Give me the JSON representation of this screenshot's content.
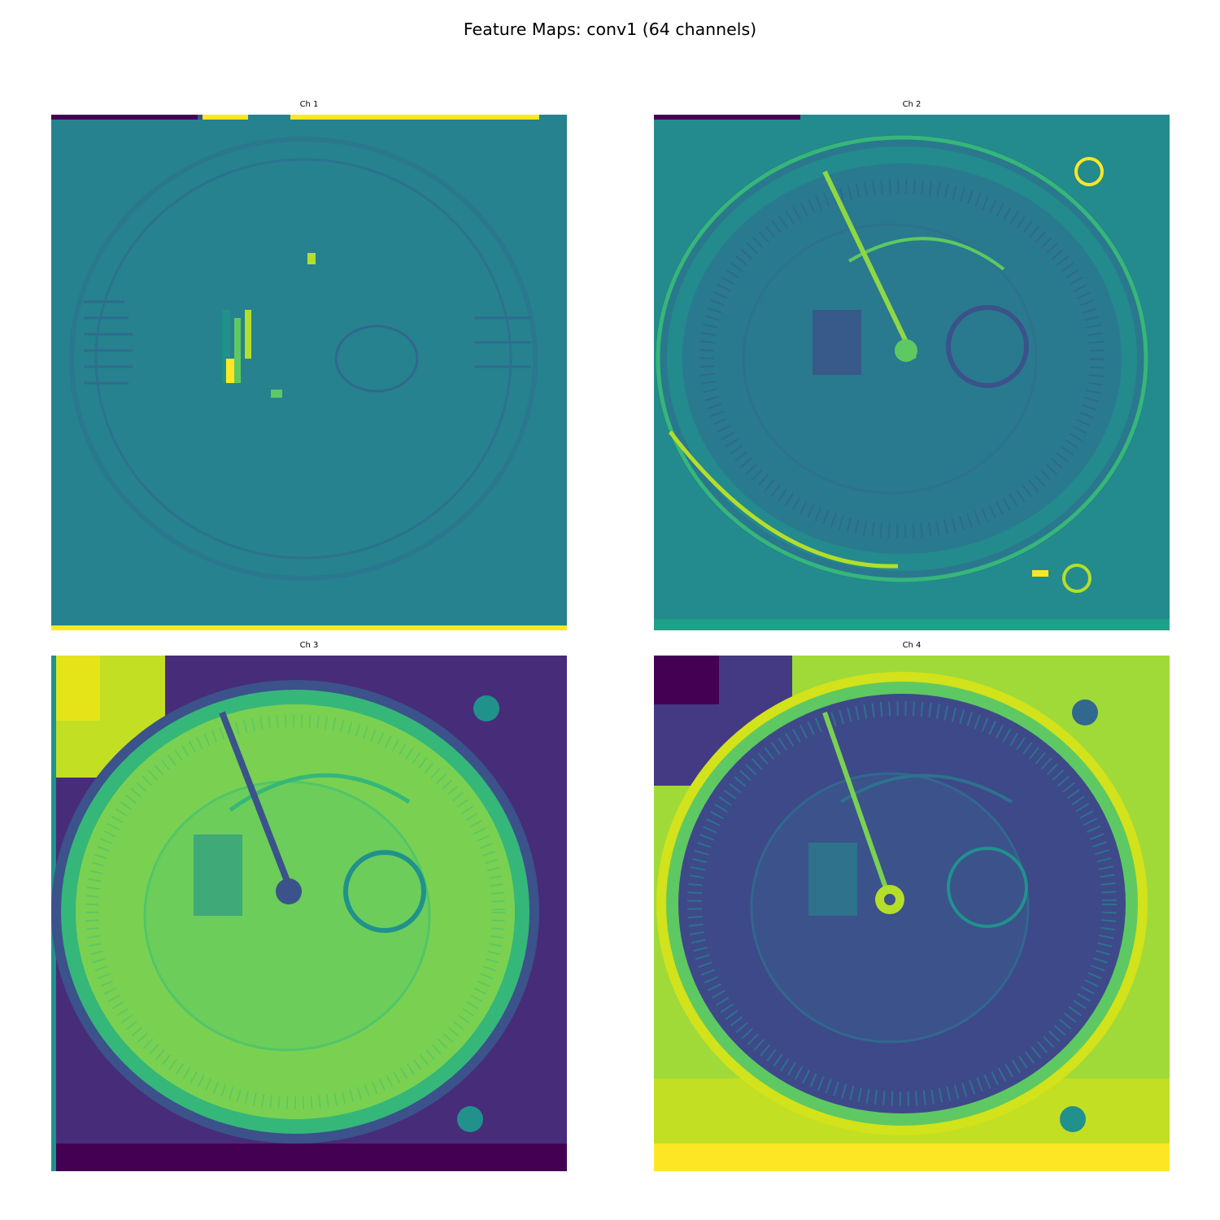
{
  "figure": {
    "title": "Feature Maps: conv1 (64 channels)"
  },
  "colormap": "viridis",
  "colors": {
    "dark": "#440154",
    "indigo": "#3b528b",
    "teal": "#21918c",
    "green": "#5ec962",
    "yellow": "#fde725"
  },
  "panels": [
    {
      "title": "Ch 1"
    },
    {
      "title": "Ch 2"
    },
    {
      "title": "Ch 3"
    },
    {
      "title": "Ch 4"
    }
  ]
}
